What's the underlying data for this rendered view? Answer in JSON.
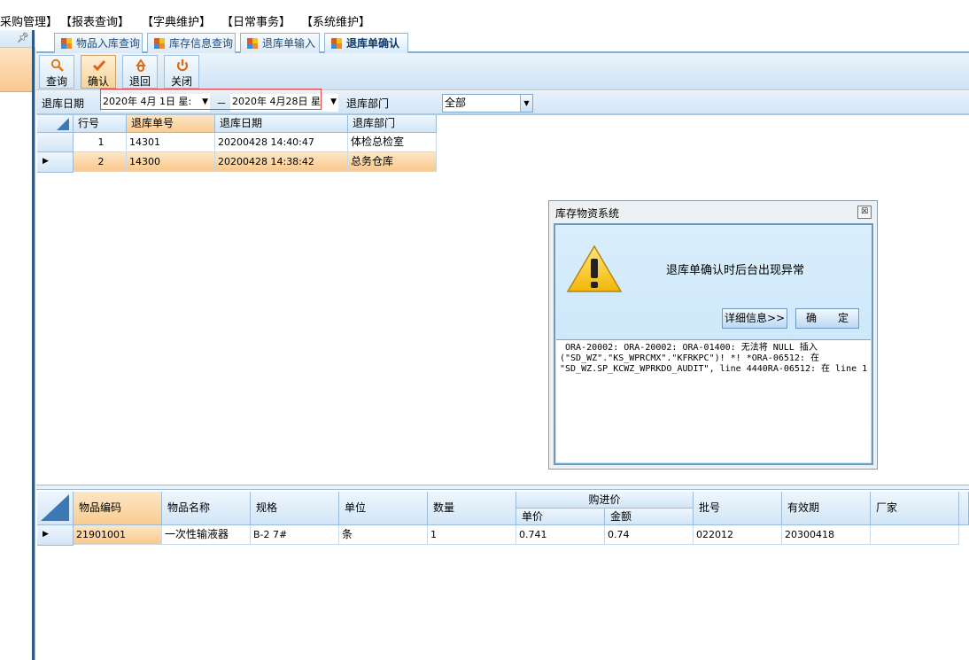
{
  "menu": [
    "采购管理】",
    "【报表查询】",
    "【字典维护】",
    "【日常事务】",
    "【系统维护】"
  ],
  "left_pane": {
    "pin_icon": "pin-icon"
  },
  "tabs": [
    {
      "label": "物品入库查询"
    },
    {
      "label": "库存信息查询"
    },
    {
      "label": "退库单输入"
    },
    {
      "label": "退库单确认"
    }
  ],
  "toolbar": {
    "query": "查询",
    "confirm": "确认",
    "return": "退回",
    "close": "关闭"
  },
  "filter": {
    "date_label": "退库日期",
    "date_from": "2020年 4月 1日 星:",
    "separator": "－",
    "date_to": "2020年 4月28日 星",
    "dept_label": "退库部门",
    "dept_value": "全部"
  },
  "upper_grid": {
    "headers": [
      "行号",
      "退库单号",
      "退库日期",
      "退库部门"
    ],
    "rows": [
      {
        "row_no": "1",
        "doc_no": "14301",
        "date": "20200428 14:40:47",
        "dept": "体检总检室"
      },
      {
        "row_no": "2",
        "doc_no": "14300",
        "date": "20200428 14:38:42",
        "dept": "总务仓库"
      }
    ]
  },
  "lower_grid": {
    "headers": {
      "code": "物品编码",
      "name": "物品名称",
      "spec": "规格",
      "unit": "单位",
      "qty": "数量",
      "purchase": "购进价",
      "unit_price": "单价",
      "amount": "金额",
      "batch": "批号",
      "expiry": "有效期",
      "maker": "厂家"
    },
    "rows": [
      {
        "code": "21901001",
        "name": "一次性输液器",
        "spec": "B-2 7#",
        "unit": "条",
        "qty": "1",
        "unit_price": "0.741",
        "amount": "0.74",
        "batch": "022012",
        "expiry": "20300418",
        "maker": ""
      }
    ]
  },
  "dialog": {
    "title": "库存物资系统",
    "message": "退库单确认时后台出现异常",
    "details_button": "详细信息>>",
    "ok_button": "确　　定",
    "detail_text": " ORA-20002: ORA-20002: ORA-01400: 无法将 NULL 插入\n(\"SD_WZ\".\"KS_WPRCMX\".\"KFRKPC\")! *! *ORA-06512: 在\n\"SD_WZ.SP_KCWZ_WPRKDO_AUDIT\", line 4440RA-06512: 在 line 1"
  },
  "colors": {
    "accent": "#2f5b82",
    "selection": "#f9cc92",
    "header": "#d2e6f7"
  }
}
